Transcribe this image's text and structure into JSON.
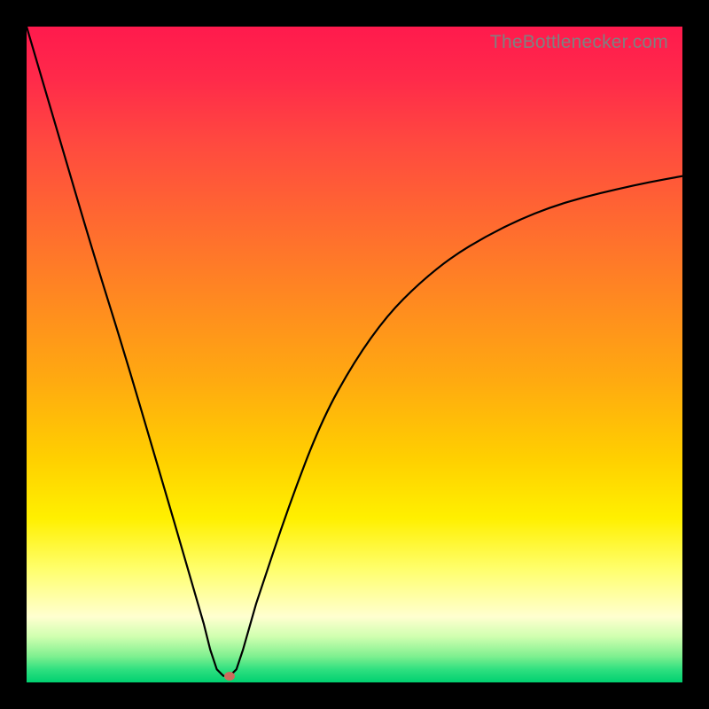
{
  "attribution": "TheBottlenecker.com",
  "colors": {
    "top": "#ff1a4d",
    "bottom": "#00d070",
    "curve": "#000000",
    "dot": "#cc6b5d",
    "frame": "#000000"
  },
  "chart_data": {
    "type": "line",
    "title": "",
    "xlabel": "",
    "ylabel": "",
    "xlim": [
      0,
      100
    ],
    "ylim": [
      0,
      100
    ],
    "notch_x": 30,
    "dot": {
      "x": 31,
      "y": 1
    },
    "series": [
      {
        "name": "curve",
        "x": [
          0,
          5,
          10,
          15,
          20,
          25,
          27,
          28,
          29,
          30,
          31,
          32,
          33,
          35,
          40,
          45,
          50,
          55,
          60,
          65,
          70,
          75,
          80,
          85,
          90,
          95,
          100
        ],
        "y": [
          100,
          83,
          66,
          50,
          33,
          16,
          9,
          5,
          2,
          1,
          1,
          2,
          5,
          12,
          27,
          40,
          49,
          56,
          61,
          65,
          68,
          70.5,
          72.5,
          74,
          75.2,
          76.3,
          77.2
        ]
      }
    ],
    "background_gradient": "vertical red→yellow→green (top=high bottleneck, bottom=low)"
  }
}
